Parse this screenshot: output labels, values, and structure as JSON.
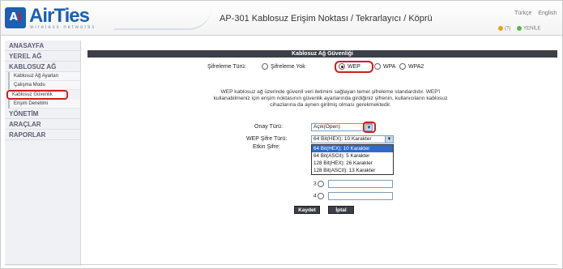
{
  "header": {
    "logo_text": "AirTies",
    "logo_sub": "wireless networks",
    "title": "AP-301 Kablosuz Erişim Noktası / Tekrarlayıcı / Köprü",
    "lang_tr": "Türkçe",
    "lang_en": "English",
    "link_help": "(?)",
    "link_new": "YENİLE"
  },
  "sidebar": {
    "items": [
      {
        "label": "ANASAYFA"
      },
      {
        "label": "YEREL AĞ"
      },
      {
        "label": "KABLOSUZ AĞ"
      },
      {
        "label": "Kablosuz Ağ Ayarları"
      },
      {
        "label": "Çalışma Modu"
      },
      {
        "label": "Kablosuz Güvenlik"
      },
      {
        "label": "Erişim Denetimi"
      },
      {
        "label": "YÖNETİM"
      },
      {
        "label": "ARAÇLAR"
      },
      {
        "label": "RAPORLAR"
      }
    ]
  },
  "main": {
    "section_title": "Kablosuz Ağ Güvenliği",
    "encryption_label": "Şifreleme Türü:",
    "encryption_options": [
      "Şifreleme Yok",
      "WEP",
      "WPA",
      "WPA2"
    ],
    "encryption_selected": "WEP",
    "info_text": "WEP kablosuz ağ üzerinde güvenli veri iletimini sağlayan temel şifreleme standardıdır. WEP'i kullanabilmeniz için erişim noktasının güvenlik ayarlarında girdiğiniz şifrenin, kullanıcıların kablosuz cihazlarına da aynen girilmiş olması gerekmektedir.",
    "auth_label": "Onay Türü:",
    "auth_value": "Açık(Open)",
    "wep_type_label": "WEP Şifre Türü:",
    "wep_type_value": "64 Bit(HEX): 10 Karakter",
    "active_key_label": "Etkin Şifre:",
    "dropdown_options": [
      "64 Bit(HEX): 10 Karakter",
      "64 Bit(ASCII): 5 Karakter",
      "128 Bit(HEX): 26 Karakter",
      "128 Bit(ASCII): 13 Karakter"
    ],
    "key_numbers": [
      "3",
      "4"
    ],
    "save_label": "Kaydet",
    "cancel_label": "İptal"
  }
}
